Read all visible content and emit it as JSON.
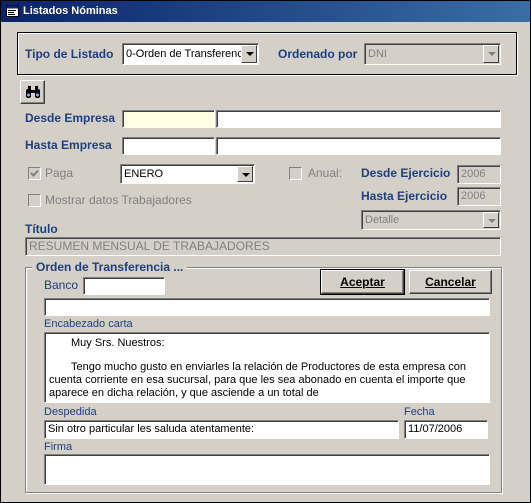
{
  "window": {
    "title": "Listados Nóminas"
  },
  "tipo_listado": {
    "label": "Tipo de Listado",
    "value": "0-Orden de Transferenc"
  },
  "ordenado_por": {
    "label": "Ordenado por",
    "value": "DNI"
  },
  "desde_empresa": {
    "label": "Desde Empresa",
    "code": "",
    "name": ""
  },
  "hasta_empresa": {
    "label": "Hasta Empresa",
    "code": "",
    "name": ""
  },
  "paga": {
    "label": "Paga",
    "checked": true,
    "value": "ENERO"
  },
  "anual": {
    "label": "Anual:",
    "checked": false
  },
  "desde_ejercicio": {
    "label": "Desde Ejercicio",
    "value": "2006"
  },
  "hasta_ejercicio": {
    "label": "Hasta Ejercicio",
    "value": "2006"
  },
  "mostrar_datos": {
    "label": "Mostrar datos Trabajadores",
    "checked": false
  },
  "detalle": {
    "value": "Detalle"
  },
  "titulo": {
    "label": "Título",
    "value": "RESUMEN MENSUAL DE TRABAJADORES"
  },
  "orden_group": {
    "label": "Orden de Transferencia ..."
  },
  "banco": {
    "label": "Banco",
    "code": "",
    "name": ""
  },
  "buttons": {
    "aceptar": "Aceptar",
    "cancelar": "Cancelar"
  },
  "encabezado": {
    "label": "Encabezado carta",
    "line1": "Muy Srs. Nuestros:",
    "line2": "Tengo mucho gusto en enviarles la relación de Productores de esta empresa con cuenta corriente en esa sucursal, para que les sea abonado en cuenta el importe que aparece en dicha relación, y que asciende a un total de"
  },
  "despedida": {
    "label": "Despedida",
    "value": "Sin otro particular les saluda atentamente:"
  },
  "fecha": {
    "label": "Fecha",
    "value": "11/07/2006"
  },
  "firma": {
    "label": "Firma",
    "value": ""
  },
  "colors": {
    "title_start": "#0a246a",
    "title_end": "#3a6ea5",
    "label_blue": "#1f3f7f",
    "face": "#d4d0c8",
    "highlight": "#ffffe1"
  },
  "icons": [
    "form-icon",
    "binoculars-icon",
    "check-icon"
  ]
}
